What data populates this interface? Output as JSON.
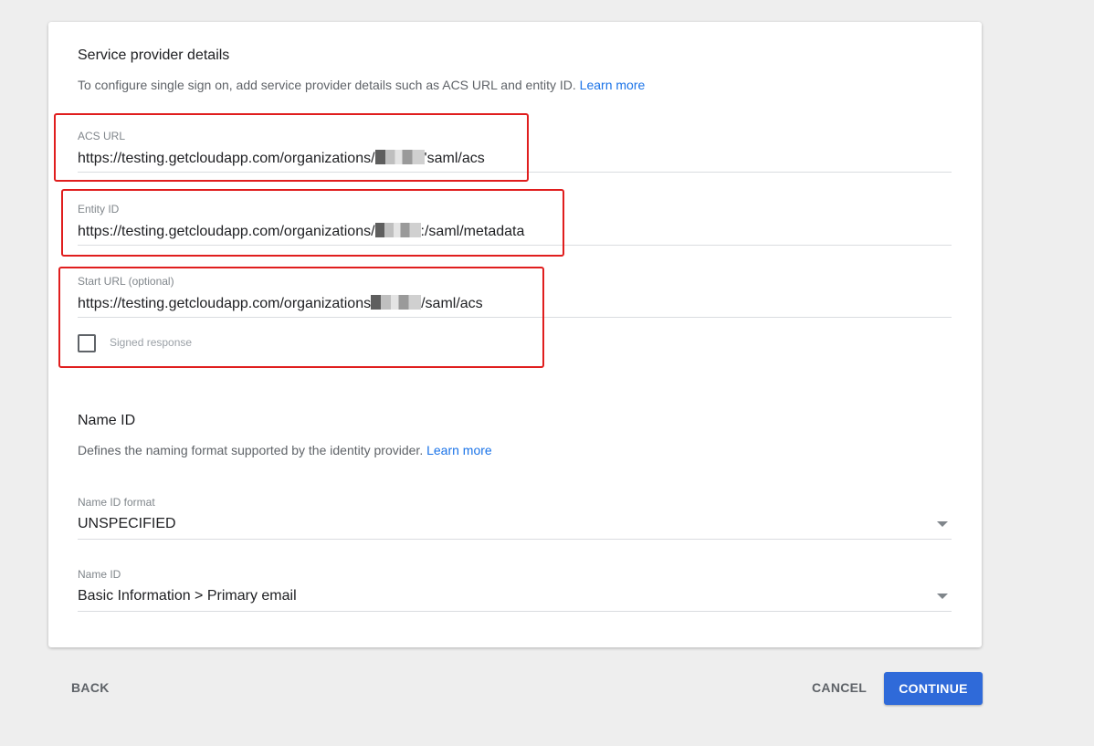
{
  "service_provider": {
    "title": "Service provider details",
    "description": "To configure single sign on, add service provider details such as ACS URL and entity ID.",
    "learn_more": "Learn more",
    "acs_url": {
      "label": "ACS URL",
      "value_prefix": "https://testing.getcloudapp.com/organizations/",
      "value_suffix": "'saml/acs"
    },
    "entity_id": {
      "label": "Entity ID",
      "value_prefix": "https://testing.getcloudapp.com/organizations/",
      "value_suffix": ":/saml/metadata"
    },
    "start_url": {
      "label": "Start URL (optional)",
      "value_prefix": "https://testing.getcloudapp.com/organizations",
      "value_suffix": "/saml/acs"
    },
    "signed_response": {
      "label": "Signed response",
      "checked": false
    }
  },
  "name_id": {
    "title": "Name ID",
    "description": "Defines the naming format supported by the identity provider.",
    "learn_more": "Learn more",
    "format": {
      "label": "Name ID format",
      "value": "UNSPECIFIED"
    },
    "name_id_field": {
      "label": "Name ID",
      "value": "Basic Information > Primary email"
    }
  },
  "footer": {
    "back_label": "BACK",
    "cancel_label": "CANCEL",
    "continue_label": "CONTINUE"
  },
  "colors": {
    "highlight": "#e01e1e",
    "link": "#1a73e8",
    "primary_button": "#2f6ad9"
  }
}
